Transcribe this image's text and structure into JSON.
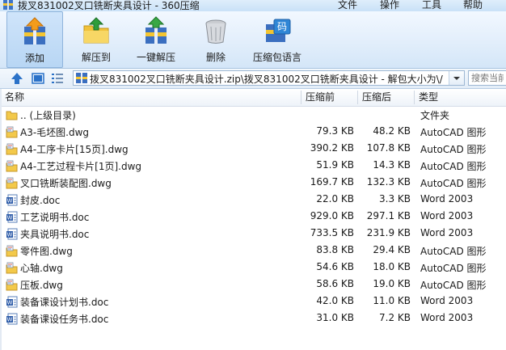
{
  "window": {
    "title": "拨叉831002叉口铣断夹具设计 - 360压缩",
    "menus": [
      "文件",
      "操作",
      "工具",
      "帮助"
    ]
  },
  "toolbar": {
    "buttons": [
      {
        "label": "添加",
        "icon": "add-archive-icon"
      },
      {
        "label": "解压到",
        "icon": "extract-to-folder-icon"
      },
      {
        "label": "一键解压",
        "icon": "one-click-extract-icon"
      },
      {
        "label": "删除",
        "icon": "trash-bin-icon"
      },
      {
        "label": "压缩包语言",
        "icon": "archive-language-icon"
      }
    ],
    "language_badge": "码"
  },
  "address": {
    "path": "拨叉831002叉口铣断夹具设计.zip\\拨叉831002叉口铣断夹具设计 - 解包大小为\\/",
    "search_placeholder": "搜索当前"
  },
  "columns": {
    "name": "名称",
    "size": "压缩前",
    "compressed": "压缩后",
    "type": "类型"
  },
  "files": [
    {
      "name": ".. (上级目录)",
      "size": "",
      "compressed": "",
      "type": "文件夹",
      "kind": "folder"
    },
    {
      "name": "A3-毛坯图.dwg",
      "size": "79.3 KB",
      "compressed": "48.2 KB",
      "type": "AutoCAD 图形",
      "kind": "dwg"
    },
    {
      "name": "A4-工序卡片[15页].dwg",
      "size": "390.2 KB",
      "compressed": "107.8 KB",
      "type": "AutoCAD 图形",
      "kind": "dwg"
    },
    {
      "name": "A4-工艺过程卡片[1页].dwg",
      "size": "51.9 KB",
      "compressed": "14.3 KB",
      "type": "AutoCAD 图形",
      "kind": "dwg"
    },
    {
      "name": "叉口铣断装配图.dwg",
      "size": "169.7 KB",
      "compressed": "132.3 KB",
      "type": "AutoCAD 图形",
      "kind": "dwg"
    },
    {
      "name": "封皮.doc",
      "size": "22.0 KB",
      "compressed": "3.3 KB",
      "type": "Word 2003",
      "kind": "doc"
    },
    {
      "name": "工艺说明书.doc",
      "size": "929.0 KB",
      "compressed": "297.1 KB",
      "type": "Word 2003",
      "kind": "doc"
    },
    {
      "name": "夹具说明书.doc",
      "size": "733.5 KB",
      "compressed": "231.9 KB",
      "type": "Word 2003",
      "kind": "doc"
    },
    {
      "name": "零件图.dwg",
      "size": "83.8 KB",
      "compressed": "29.4 KB",
      "type": "AutoCAD 图形",
      "kind": "dwg"
    },
    {
      "name": "心轴.dwg",
      "size": "54.6 KB",
      "compressed": "18.0 KB",
      "type": "AutoCAD 图形",
      "kind": "dwg"
    },
    {
      "name": "压板.dwg",
      "size": "58.6 KB",
      "compressed": "19.0 KB",
      "type": "AutoCAD 图形",
      "kind": "dwg"
    },
    {
      "name": "装备课设计划书.doc",
      "size": "42.0 KB",
      "compressed": "11.0 KB",
      "type": "Word 2003",
      "kind": "doc"
    },
    {
      "name": "装备课设任务书.doc",
      "size": "31.0 KB",
      "compressed": "7.2 KB",
      "type": "Word 2003",
      "kind": "doc"
    }
  ],
  "colors": {
    "toolbar_top": "#f2f8ff",
    "toolbar_bottom": "#d4e6f8",
    "folder_yellow": "#f3c94a",
    "word_blue": "#2b5aa8"
  }
}
